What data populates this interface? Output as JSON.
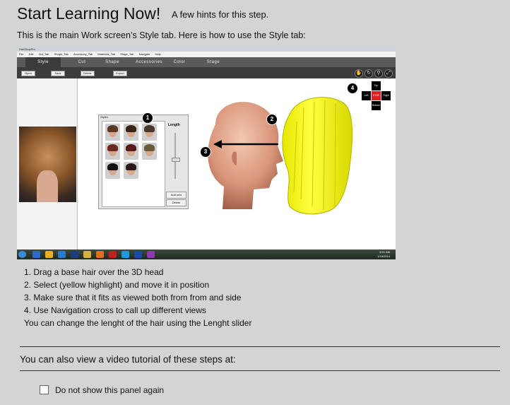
{
  "header": {
    "title": "Start Learning Now!",
    "subtitle": "A few hints for this step.",
    "intro": "This is the main Work screen’s Style tab. Here is how to use the Style tab:"
  },
  "screenshot": {
    "app_title": "HairShopPro",
    "menu": [
      "File",
      "Edit",
      "Cut_Tab",
      "Shape_Tab",
      "Accessory_Tab",
      "Materials_Tab",
      "Stage_Tab",
      "Navigate",
      "Help"
    ],
    "tabs": [
      "Style",
      "Cut",
      "Shape",
      "Accessories",
      "Color",
      "Stage"
    ],
    "toolbar": {
      "open": "Open",
      "save": "Save",
      "delete": "Delete",
      "export": "Export"
    },
    "styles_panel": {
      "title": "Styles",
      "length_label": "Length",
      "add_new": "Add new",
      "delete": "Delete"
    },
    "markers": [
      "1",
      "2",
      "3",
      "4"
    ],
    "navigation": {
      "top": "Top",
      "left": "Left",
      "stop": "STOP",
      "right": "Right",
      "bottom": "Bottom"
    },
    "clock": {
      "time": "6:21 AM",
      "date": "1/16/2014"
    }
  },
  "steps": [
    "1. Drag a base hair over the 3D head",
    "2. Select (yellow highlight) and move it in position",
    "3. Make sure that it fits as viewed both from from and side",
    "4. Use Navigation cross to call up different views"
  ],
  "note": "You can change the lenght of the hair using the Lenght slider",
  "video_text": "You can also view a video tutorial of these steps at:",
  "checkbox_label": "Do not show this panel again",
  "colors": {
    "background": "#d4d4d4",
    "hair": "#ffff00",
    "stop": "#e02020"
  }
}
